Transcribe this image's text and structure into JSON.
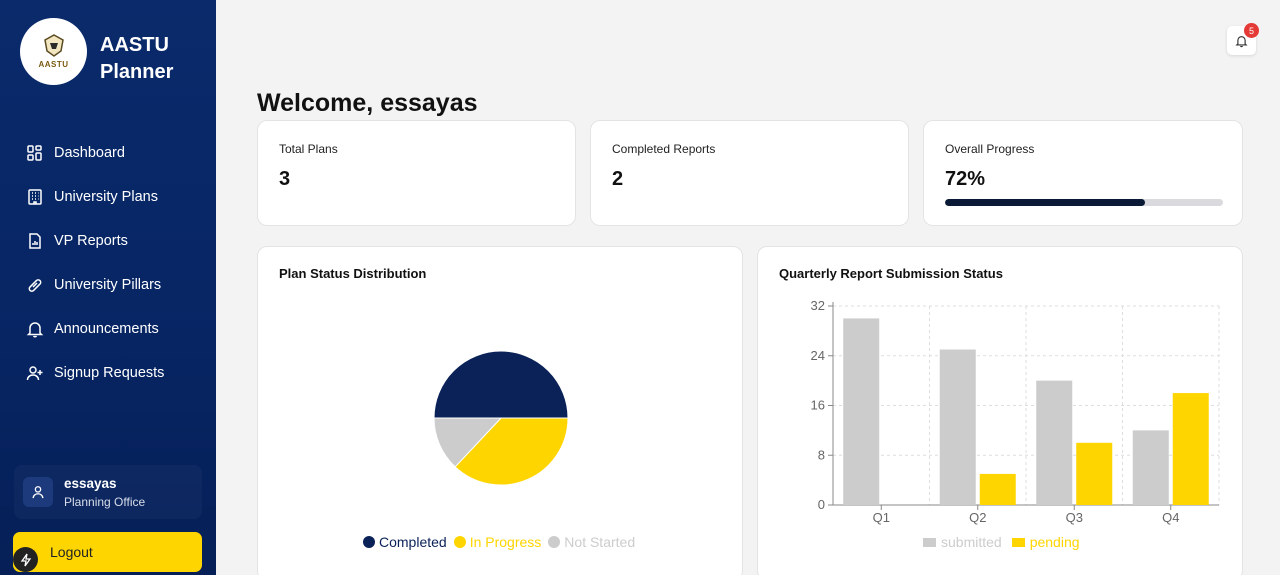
{
  "app": {
    "brand_line1": "AASTU",
    "brand_line2": "Planner",
    "logo_text": "AASTU"
  },
  "sidebar": {
    "items": [
      {
        "label": "Dashboard",
        "icon": "dashboard-icon"
      },
      {
        "label": "University Plans",
        "icon": "building-icon"
      },
      {
        "label": "VP Reports",
        "icon": "report-icon"
      },
      {
        "label": "University Pillars",
        "icon": "link-icon"
      },
      {
        "label": "Announcements",
        "icon": "bell-icon"
      },
      {
        "label": "Signup Requests",
        "icon": "user-plus-icon"
      }
    ],
    "user": {
      "name": "essayas",
      "role": "Planning Office"
    },
    "logout_label": "Logout"
  },
  "header": {
    "notification_count": "5",
    "welcome": "Welcome, essayas"
  },
  "stats": {
    "total_plans": {
      "label": "Total Plans",
      "value": "3"
    },
    "completed_reports": {
      "label": "Completed Reports",
      "value": "2"
    },
    "overall_progress": {
      "label": "Overall Progress",
      "value": "72%",
      "fraction": 0.72
    }
  },
  "colors": {
    "navy": "#0a2258",
    "yellow": "#ffd500",
    "gray": "#cccccc",
    "accent": "#e53935"
  },
  "chart_data": [
    {
      "type": "pie",
      "title": "Plan Status Distribution",
      "labels": [
        "Completed",
        "In Progress",
        "Not Started"
      ],
      "values": [
        50,
        37,
        13
      ],
      "colors": [
        "#0a2258",
        "#ffd500",
        "#cccccc"
      ],
      "legend": "bottom"
    },
    {
      "type": "bar",
      "title": "Quarterly Report Submission Status",
      "categories": [
        "Q1",
        "Q2",
        "Q3",
        "Q4"
      ],
      "series": [
        {
          "name": "submitted",
          "values": [
            30,
            25,
            20,
            12
          ],
          "color": "#cccccc"
        },
        {
          "name": "pending",
          "values": [
            0,
            5,
            10,
            18
          ],
          "color": "#ffd500"
        }
      ],
      "ylim": [
        0,
        32
      ],
      "yticks": [
        "0",
        "8",
        "16",
        "24",
        "32"
      ],
      "grid": true,
      "legend": "bottom"
    }
  ]
}
